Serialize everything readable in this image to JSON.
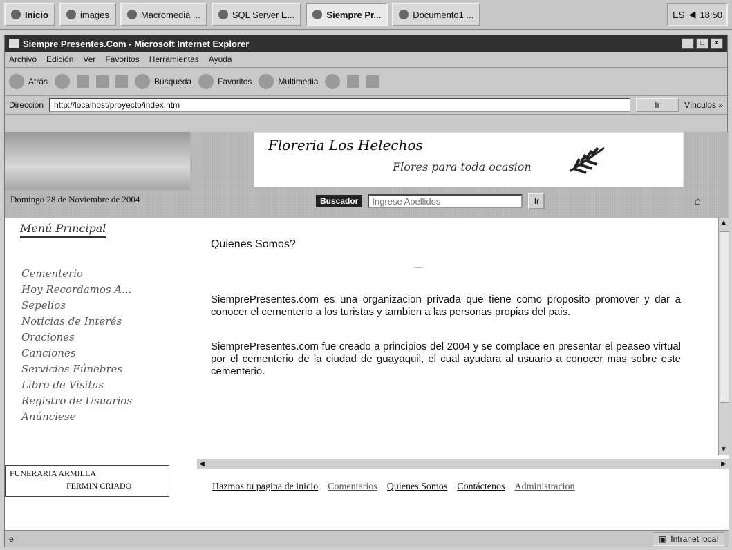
{
  "taskbar": {
    "start": "Inicio",
    "buttons": [
      {
        "label": "images"
      },
      {
        "label": "Macromedia ..."
      },
      {
        "label": "SQL Server E..."
      },
      {
        "label": "Siempre Pr..."
      },
      {
        "label": "Documento1 ..."
      }
    ],
    "tray": {
      "lang": "ES",
      "time": "18:50"
    }
  },
  "window": {
    "title": "Siempre Presentes.Com - Microsoft Internet Explorer",
    "menu": [
      "Archivo",
      "Edición",
      "Ver",
      "Favoritos",
      "Herramientas",
      "Ayuda"
    ],
    "toolbar": {
      "back": "Atrás",
      "search": "Búsqueda",
      "favorites": "Favoritos",
      "multimedia": "Multimedia"
    },
    "address_label": "Dirección",
    "address_url": "http://localhost/proyecto/index.htm",
    "go_label": "Ir",
    "links_label": "Vínculos »"
  },
  "page": {
    "logo": {
      "title": "Floreria Los Helechos",
      "subtitle": "Flores para toda ocasion"
    },
    "date": "Domingo 28 de Noviembre de 2004",
    "search": {
      "label": "Buscador",
      "placeholder": "Ingrese Apellidos",
      "button": "Ir"
    },
    "menu_title": "Menú Principal",
    "menu_items": [
      "Cementerio",
      "Hoy Recordamos A...",
      "Sepelios",
      "Noticias de Interés",
      "Oraciones",
      "Canciones",
      "Servicios Fúnebres",
      "Libro de Visitas",
      "Registro de Usuarios",
      "Anúnciese"
    ],
    "funeraria": {
      "line1": "FUNERARIA ARMILLA",
      "line2": "FERMIN CRIADO"
    },
    "main_title": "Quienes Somos?",
    "paragraphs": [
      "SiemprePresentes.com es una organizacion privada que tiene como proposito promover y dar a conocer el cementerio a los turistas y tambien a las personas propias del pais.",
      "SiemprePresentes.com fue creado a principios del 2004 y se complace en presentar el peaseo virtual por el cementerio de la ciudad de guayaquil, el cual ayudara al usuario a conocer mas sobre este cementerio."
    ],
    "footer_links": [
      "Hazmos tu pagina de inicio",
      "Comentarios",
      "Quienes Somos",
      "Contáctenos",
      "Administracion"
    ]
  },
  "statusbar": {
    "zone": "Intranet local"
  }
}
